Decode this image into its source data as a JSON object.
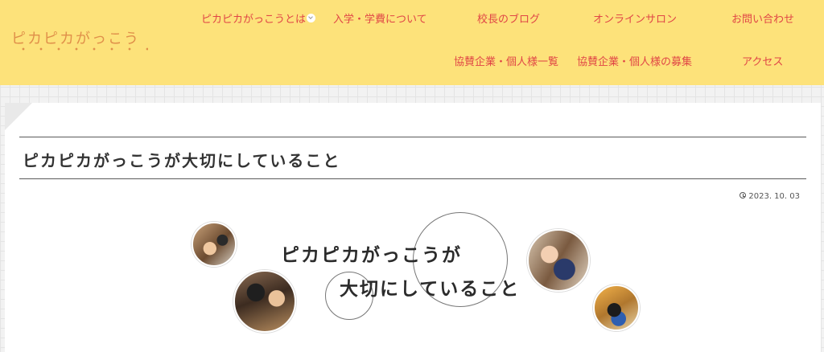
{
  "site": {
    "logo": "ピカピカがっこう"
  },
  "nav": {
    "items": [
      {
        "label": "ピカピカがっこうとは"
      },
      {
        "label": "入学・学費について"
      },
      {
        "label": "校長のブログ"
      },
      {
        "label": "オンラインサロン"
      },
      {
        "label": "お問い合わせ"
      },
      {
        "label": "協賛企業・個人様一覧"
      },
      {
        "label": "協賛企業・個人様の募集"
      },
      {
        "label": "アクセス"
      }
    ]
  },
  "post": {
    "title": "ピカピカがっこうが大切にしていること",
    "date": "2023. 10. 03",
    "hero_line1": "ピカピカがっこうが",
    "hero_line2": "大切にしていること"
  },
  "colors": {
    "header_bg": "#fde27a",
    "nav_text": "#e04646",
    "logo_text": "#e0904a"
  }
}
